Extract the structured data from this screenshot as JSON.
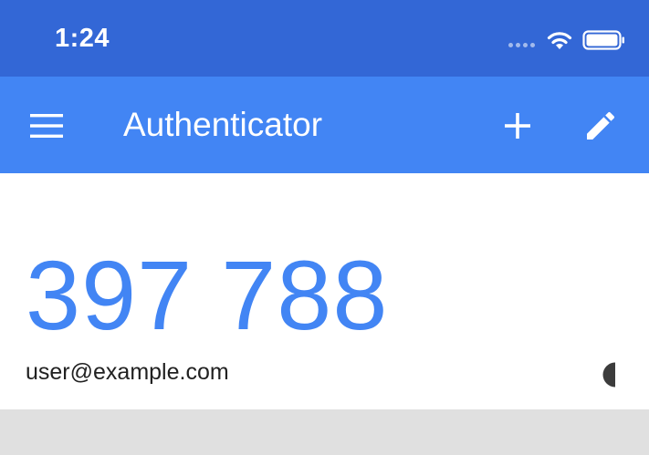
{
  "status_bar": {
    "time": "1:24",
    "color": "#3367d6"
  },
  "app_bar": {
    "title": "Authenticator",
    "color": "#4285f4",
    "icons": {
      "menu": "menu-icon",
      "add": "add-icon",
      "edit": "edit-icon"
    }
  },
  "account": {
    "code": "397 788",
    "name": "user@example.com",
    "code_color": "#4285f4",
    "timer_icon": "countdown-timer-icon"
  }
}
